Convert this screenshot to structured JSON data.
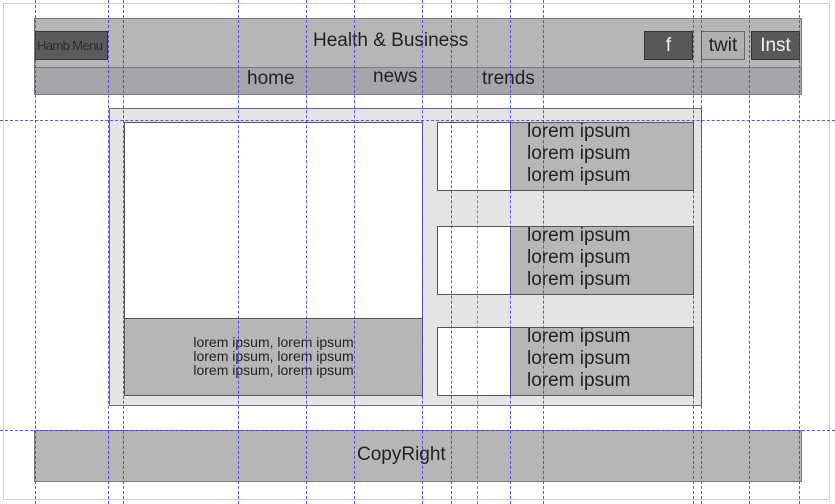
{
  "header": {
    "menu_label": "Hamb Menu",
    "title": "Health & Business",
    "social": {
      "facebook": "f",
      "twitter": "twit",
      "instagram": "Inst"
    }
  },
  "nav": {
    "items": [
      "home",
      "news",
      "trends"
    ]
  },
  "hero": {
    "caption_lines": [
      "lorem ipsum, lorem ipsum",
      "lorem ipsum, lorem ipsum",
      "lorem ipsum, lorem ipsum"
    ]
  },
  "cards": [
    {
      "lines": [
        "lorem ipsum",
        "lorem ipsum",
        "lorem ipsum"
      ]
    },
    {
      "lines": [
        "lorem ipsum",
        "lorem ipsum",
        "lorem ipsum"
      ]
    },
    {
      "lines": [
        "lorem ipsum",
        "lorem ipsum",
        "lorem ipsum"
      ]
    }
  ],
  "footer": {
    "text": "CopyRight"
  },
  "colors": {
    "panel_gray": "#b6b6b9",
    "dark_button": "#58585b",
    "content_bg": "#e4e4e6",
    "guide_blue": "#3a3ae0",
    "guide_red": "#e04848"
  }
}
